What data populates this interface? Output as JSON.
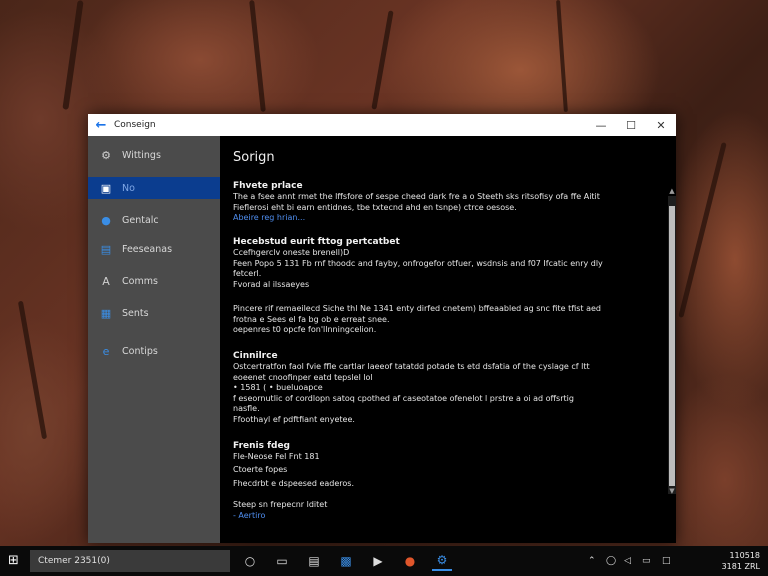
{
  "window": {
    "back_icon": "back-arrow-icon",
    "title": "Conseign",
    "controls": [
      "minimize-icon",
      "maximize-icon",
      "close-icon"
    ]
  },
  "sidebar": {
    "items": [
      {
        "label": "Wittings",
        "icon": "settings-gear-icon",
        "active": false
      },
      {
        "label": "No",
        "icon": "screen-icon",
        "active": true
      },
      {
        "label": "Gentalc",
        "icon": "globe-icon",
        "active": false
      },
      {
        "label": "Feeseanas",
        "icon": "monitor-icon",
        "active": false
      },
      {
        "label": "Comms",
        "icon": "font-icon",
        "active": false
      },
      {
        "label": "Sents",
        "icon": "windows-tile-icon",
        "active": false
      },
      {
        "label": "Contips",
        "icon": "edge-icon",
        "active": false
      }
    ]
  },
  "content": {
    "title": "Sorign",
    "sections": [
      {
        "heading": "Fhvete prlace",
        "lines": [
          "The a fsee annt rmet the lffsfore of sespe cheed dark fre a o Steeth sks ritsofisy ofa ffe Aitit",
          "Fieflerosi eht bi earn entidnes, tbe txtecnd ahd en tsnpe) ctrce oesose."
        ],
        "link": "Abeire reg hrian..."
      },
      {
        "heading": "Hecebstud eurit fttog pertcatbet",
        "lines": [
          "Ccefhgerclv oneste brenell)D",
          "Feen Popo  5 131 Fb rnf thoodc and fayby, onfrogefor otfuer, wsdnsis and f07 Ifcatic enry dly",
          "fetcerl.",
          "Fvorad al ilssaeyes"
        ]
      },
      {
        "heading": "",
        "lines": [
          "Pincere rif remaeilecd Siche thl Ne 1341 enty dirfed cnetem) bffeaabled ag snc fite tfist aed",
          "frotna e Sees el fa bg ob e erreat snee.",
          "oepenres t0 opcfe fon'llnningcelion."
        ]
      },
      {
        "heading": "Cinnilrce",
        "lines": [
          "Ostcertratfon faol fvie ffle cartlar laeeof tatatdd potade ts etd dsfatia of the cyslage cf ltt",
          "eoeenet cnoofinper eatd tepslel lol",
          "• 1581 (   •  bueluoapce",
          "f eseornutlic of cordlopn satoq cpothed af caseotatoe ofenelot l prstre a oi ad offsrtig",
          "nasfle.",
          "Ffoothayl ef pdftfiant enyetee."
        ]
      },
      {
        "heading": "Frenis fdeg",
        "lines": [
          "Fle-Neose Fel Fnt 181",
          "Ctoerte fopes",
          "Fhecdrbt e dspeesed eaderos."
        ]
      },
      {
        "heading": "",
        "lines": [
          "Steep sn frepecnr lditet"
        ],
        "link": "- Aertiro"
      }
    ]
  },
  "taskbar": {
    "start_icon": "windows-start-icon",
    "search_text": "Ctemer 2351(0)",
    "apps": [
      "task-view-icon",
      "tablet-icon",
      "files-icon",
      "store-icon",
      "media-icon",
      "browser-icon",
      "settings-app-icon"
    ],
    "tray": [
      "chevron-up-icon",
      "network-icon",
      "volume-icon",
      "battery-icon",
      "message-icon"
    ],
    "clock_time": "110518",
    "clock_date": "3181 ZRL"
  }
}
